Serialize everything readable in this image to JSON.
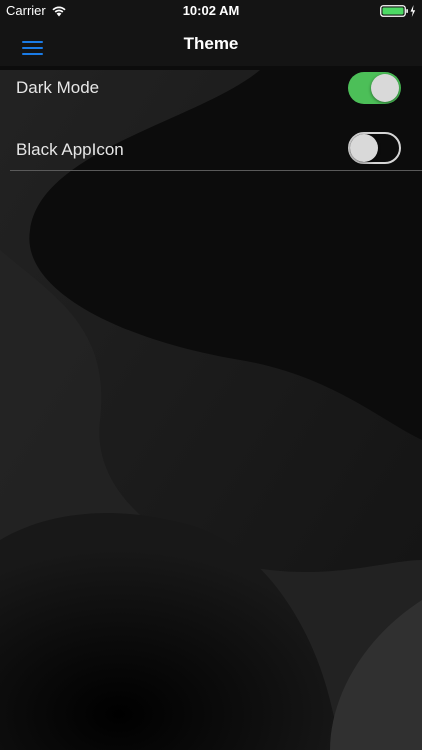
{
  "status_bar": {
    "carrier": "Carrier",
    "time": "10:02 AM",
    "battery_color": "#4cd964",
    "wifi_icon": "wifi-icon",
    "battery_icon": "battery-charging-icon"
  },
  "nav": {
    "title": "Theme",
    "menu_icon": "hamburger-menu-icon",
    "accent_color": "#1a7be6"
  },
  "settings": [
    {
      "label": "Dark Mode",
      "enabled": true
    },
    {
      "label": "Black AppIcon",
      "enabled": false
    }
  ],
  "colors": {
    "switch_on": "#4cbf58",
    "background": "#0b0b0b",
    "text": "#e6e6e6"
  }
}
